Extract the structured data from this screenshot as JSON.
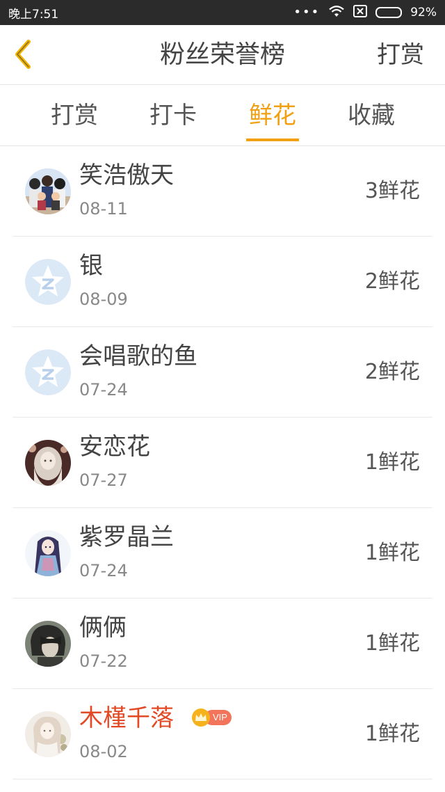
{
  "status_bar": {
    "time": "晚上7:51",
    "dots": "•••",
    "battery_percent": "92%",
    "battery_level": 0.92,
    "icons": [
      "wifi-icon",
      "sim-off-icon",
      "battery-icon"
    ]
  },
  "header": {
    "title": "粉丝荣誉榜",
    "right_action": "打赏",
    "back_icon": "chevron-left-icon"
  },
  "tabs": [
    {
      "label": "打赏",
      "active": false
    },
    {
      "label": "打卡",
      "active": false
    },
    {
      "label": "鲜花",
      "active": true
    },
    {
      "label": "收藏",
      "active": false
    }
  ],
  "colors": {
    "accent": "#f0a012",
    "vip_name": "#e24a26",
    "vip_pill": "#f2745a",
    "crown": "#f6b21d"
  },
  "fans": [
    {
      "name": "笑浩傲天",
      "date": "08-11",
      "count": "3鲜花",
      "avatar": "group-photo-avatar",
      "vip": false
    },
    {
      "name": "银",
      "date": "08-09",
      "count": "2鲜花",
      "avatar": "default-star-avatar",
      "vip": false
    },
    {
      "name": "会唱歌的鱼",
      "date": "07-24",
      "count": "2鲜花",
      "avatar": "default-star-avatar",
      "vip": false
    },
    {
      "name": "安恋花",
      "date": "07-27",
      "count": "1鲜花",
      "avatar": "anime-girl-avatar",
      "vip": false
    },
    {
      "name": "紫罗晶兰",
      "date": "07-24",
      "count": "1鲜花",
      "avatar": "anime-girl-avatar",
      "vip": false
    },
    {
      "name": "俩俩",
      "date": "07-22",
      "count": "1鲜花",
      "avatar": "dark-hair-avatar",
      "vip": false
    },
    {
      "name": "木槿千落",
      "date": "08-02",
      "count": "1鲜花",
      "avatar": "anime-girl-avatar",
      "vip": true,
      "vip_label": "VIP"
    }
  ]
}
